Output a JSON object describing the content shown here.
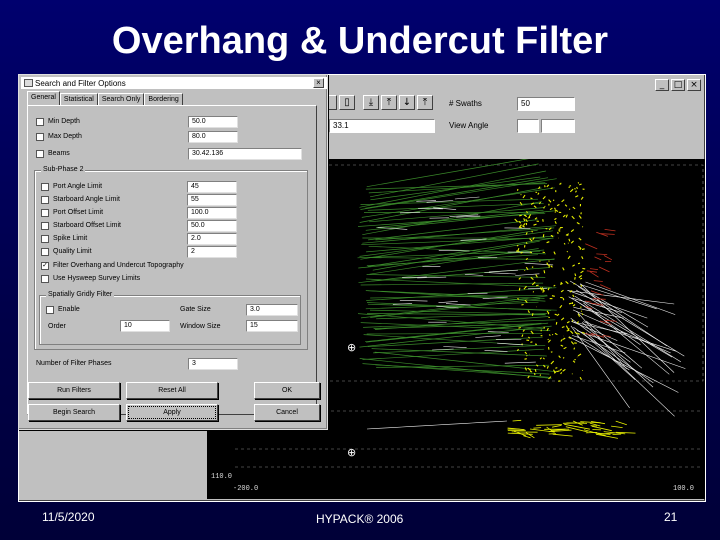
{
  "slide": {
    "title": "Overhang & Undercut Filter",
    "date": "11/5/2020",
    "center_text": "HYPACK® 2006",
    "page_number": "21"
  },
  "main_window": {
    "controls": [
      "_",
      "□",
      "×"
    ],
    "toolbar_icons": [
      "sort-down-icon",
      "sort-up-icon",
      "arrow-down-icon",
      "arrow-up-icon",
      "sort-up-alt-icon"
    ],
    "swaths_label": "# Swaths",
    "swaths_value": "50",
    "view_angle_label": "View Angle",
    "left_field_value": "33.1",
    "plot": {
      "y_axis_bottom": "110.0",
      "x_axis_min": "-200.0",
      "x_axis_max": "100.0"
    }
  },
  "dialog": {
    "title": "Search and Filter Options",
    "close_label": "×",
    "tabs": [
      "General",
      "Statistical",
      "Search Only",
      "Bordering"
    ],
    "active_tab": "General",
    "min_depth": {
      "label": "Min Depth",
      "value": "50.0",
      "checked": false
    },
    "max_depth": {
      "label": "Max Depth",
      "value": "80.0",
      "checked": false
    },
    "beams": {
      "label": "Beams",
      "value": "30.42.136",
      "checked": false
    },
    "sub_phase": {
      "title": "Sub-Phase 2",
      "items": [
        {
          "label": "Port Angle Limit",
          "value": "45",
          "checked": false
        },
        {
          "label": "Starboard Angle Limit",
          "value": "55",
          "checked": false
        },
        {
          "label": "Port Offset Limit",
          "value": "100.0",
          "checked": false
        },
        {
          "label": "Starboard Offset Limit",
          "value": "50.0",
          "checked": false
        },
        {
          "label": "Spike Limit",
          "value": "2.0",
          "checked": false
        },
        {
          "label": "Quality Limit",
          "value": "2",
          "checked": false
        },
        {
          "label": "Filter Overhang and Undercut Topography",
          "value": "",
          "checked": true
        },
        {
          "label": "Use Hysweep Survey Limits",
          "value": "",
          "checked": false
        }
      ]
    },
    "spatially": {
      "title": "Spatially Gridly Filter",
      "enable_label": "Enable",
      "enable_checked": false,
      "gate_size_label": "Gate Size",
      "gate_size_value": "3.0",
      "order_label": "Order",
      "order_value": "10",
      "window_size_label": "Window Size",
      "window_size_value": "15"
    },
    "number_of_phases_label": "Number of Filter Phases",
    "number_of_phases_value": "3",
    "buttons": {
      "run_filters": "Run Filters",
      "reset_all": "Reset All",
      "ok": "OK",
      "begin_search": "Begin Search",
      "apply": "Apply",
      "cancel": "Cancel"
    }
  },
  "colors": {
    "background": "#00006e",
    "plot_bg": "#000000",
    "data_green": "#3a8a2a",
    "data_yellow": "#e8f000",
    "data_white": "#f0f0f0",
    "data_red": "#c03020"
  }
}
